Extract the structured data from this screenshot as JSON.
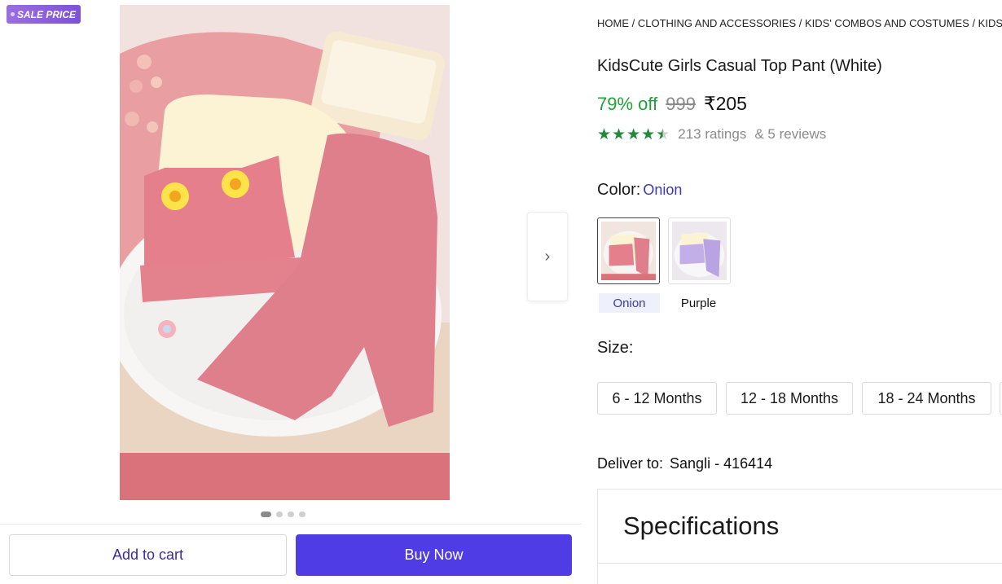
{
  "badge": {
    "label": "SALE PRICE"
  },
  "product": {
    "breadcrumb": "HOME / CLOTHING AND ACCESSORIES / KIDS' COMBOS AND COSTUMES / KIDS' A",
    "title": "KidsCute Girls Casual Top Pant (White)",
    "discount": "79% off",
    "mrp": "999",
    "price": "₹205",
    "rating_value": 4.5,
    "ratings_text": "213 ratings",
    "reviews_text": "& 5 reviews"
  },
  "color": {
    "label": "Color:",
    "selected": "Onion",
    "options": [
      {
        "name": "Onion",
        "hex": "#d9727a"
      },
      {
        "name": "Purple",
        "hex": "#b9a3e3"
      }
    ]
  },
  "size": {
    "label": "Size:",
    "options": [
      "6 - 12 Months",
      "12 - 18 Months",
      "18 - 24 Months"
    ]
  },
  "delivery": {
    "label": "Deliver to:",
    "location": "Sangli - 416414"
  },
  "specifications": {
    "title": "Specifications"
  },
  "actions": {
    "add_to_cart": "Add to cart",
    "buy_now": "Buy Now"
  },
  "carousel": {
    "total": 4,
    "active": 1
  },
  "colors": {
    "accent": "#4f3ce4",
    "discount": "#22a03a",
    "star": "#1f8a3a"
  },
  "icons": {
    "next": "chevron-right-icon",
    "star": "star-icon"
  }
}
